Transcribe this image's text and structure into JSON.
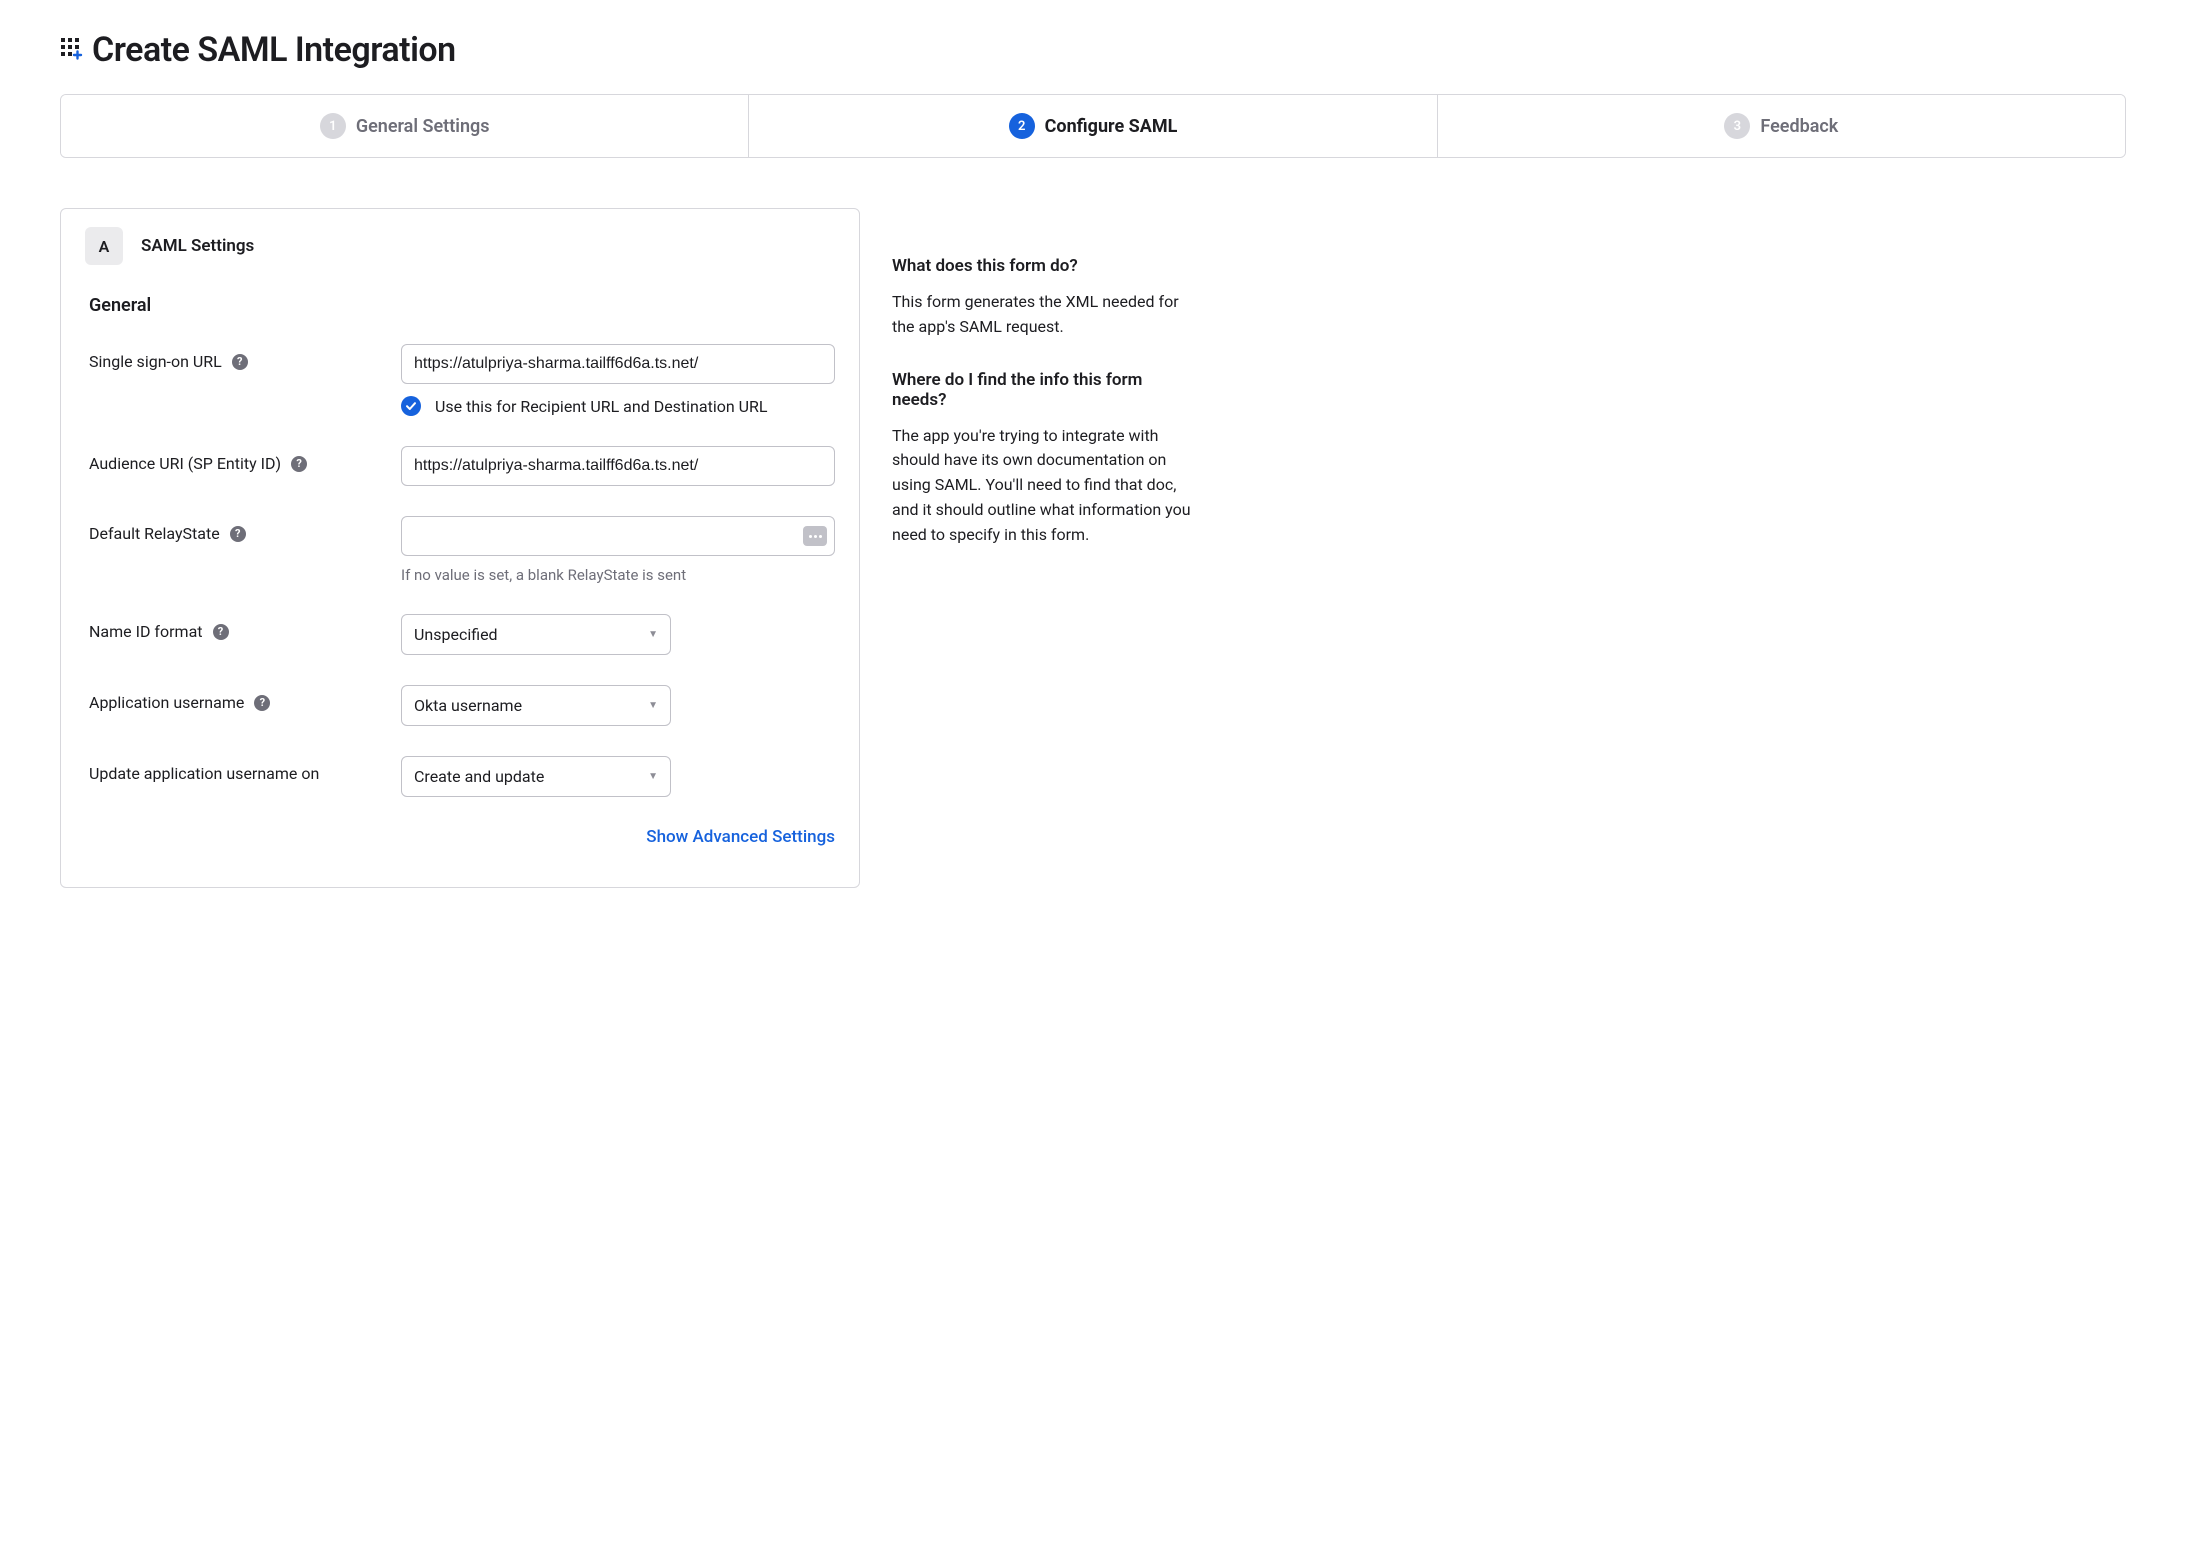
{
  "page": {
    "title": "Create SAML Integration"
  },
  "stepper": {
    "steps": [
      {
        "num": "1",
        "label": "General Settings"
      },
      {
        "num": "2",
        "label": "Configure SAML"
      },
      {
        "num": "3",
        "label": "Feedback"
      }
    ]
  },
  "form": {
    "section_badge": "A",
    "section_title": "SAML Settings",
    "subheader": "General",
    "sso": {
      "label": "Single sign-on URL",
      "value": "https://atulpriya-sharma.tailff6d6a.ts.net/",
      "checkbox_label": "Use this for Recipient URL and Destination URL"
    },
    "audience": {
      "label": "Audience URI (SP Entity ID)",
      "value": "https://atulpriya-sharma.tailff6d6a.ts.net/"
    },
    "relay": {
      "label": "Default RelayState",
      "value": "",
      "hint": "If no value is set, a blank RelayState is sent"
    },
    "nameid": {
      "label": "Name ID format",
      "value": "Unspecified"
    },
    "appuser": {
      "label": "Application username",
      "value": "Okta username"
    },
    "updateon": {
      "label": "Update application username on",
      "value": "Create and update"
    },
    "advanced_link": "Show Advanced Settings"
  },
  "sidebar": {
    "q1": "What does this form do?",
    "a1": "This form generates the XML needed for the app's SAML request.",
    "q2": "Where do I find the info this form needs?",
    "a2": "The app you're trying to integrate with should have its own documentation on using SAML. You'll need to find that doc, and it should outline what information you need to specify in this form."
  }
}
